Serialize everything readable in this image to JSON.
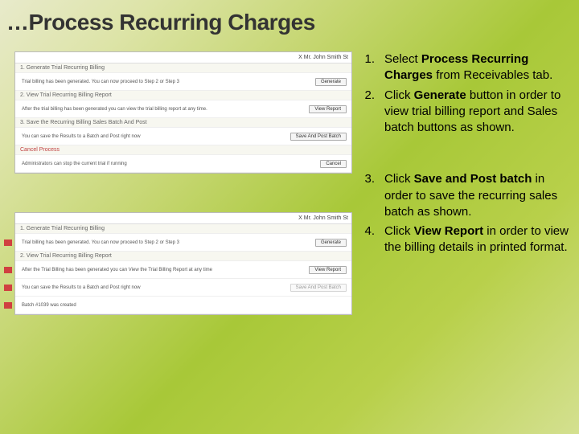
{
  "title": "…Process Recurring Charges",
  "shot1": {
    "user": "X Mr. John Smith St",
    "row1_head": "1. Generate Trial Recurring Billing",
    "row1_body": "Trial billing has been generated. You can now proceed to Step 2 or Step 3",
    "row1_btn": "Generate",
    "row2_head": "2. View Trial Recurring Billing Report",
    "row2_body": "After the trial billing has been generated you can view the trial billing report at any time.",
    "row2_btn": "View Report",
    "row3_head": "3. Save the Recurring Billing Sales Batch And Post",
    "row3_body": "You can save the Results to a Batch and Post right now",
    "row3_btn": "Save And Post Batch",
    "row4_head": "Cancel Process",
    "row4_body": "Administrators can stop the current trial if running",
    "row4_btn": "Cancel"
  },
  "shot2": {
    "user": "X Mr. John Smith St",
    "row1_head": "1. Generate Trial Recurring Billing",
    "row1_body": "Trial billing has been generated. You can now proceed to Step 2 or Step 3",
    "row1_btn": "Generate",
    "row2_head": "2. View Trial Recurring Billing Report",
    "row2_body": "After the Trial Billing has been generated you can View the Trial Billing Report at any time",
    "row2_btn": "View Report",
    "row3_head": "You can save the Results to a Batch and Post right now",
    "row3_btn": "Save And Post Batch",
    "row4_head": "Batch #1039 was created"
  },
  "steps_a": [
    {
      "n": "1.",
      "pre": "Select ",
      "bold": "Process Recurring Charges",
      "post": " from Receivables tab."
    },
    {
      "n": "2.",
      "pre": "Click ",
      "bold": "Generate",
      "post": " button in order to view trial billing report and Sales batch buttons as shown."
    }
  ],
  "steps_b": [
    {
      "n": "3.",
      "pre": "Click ",
      "bold": "Save and Post batch",
      "post": " in order to save the recurring sales batch as shown."
    },
    {
      "n": "4.",
      "pre": "Click ",
      "bold": "View Report",
      "post": " in order to view the billing details in printed format."
    }
  ]
}
